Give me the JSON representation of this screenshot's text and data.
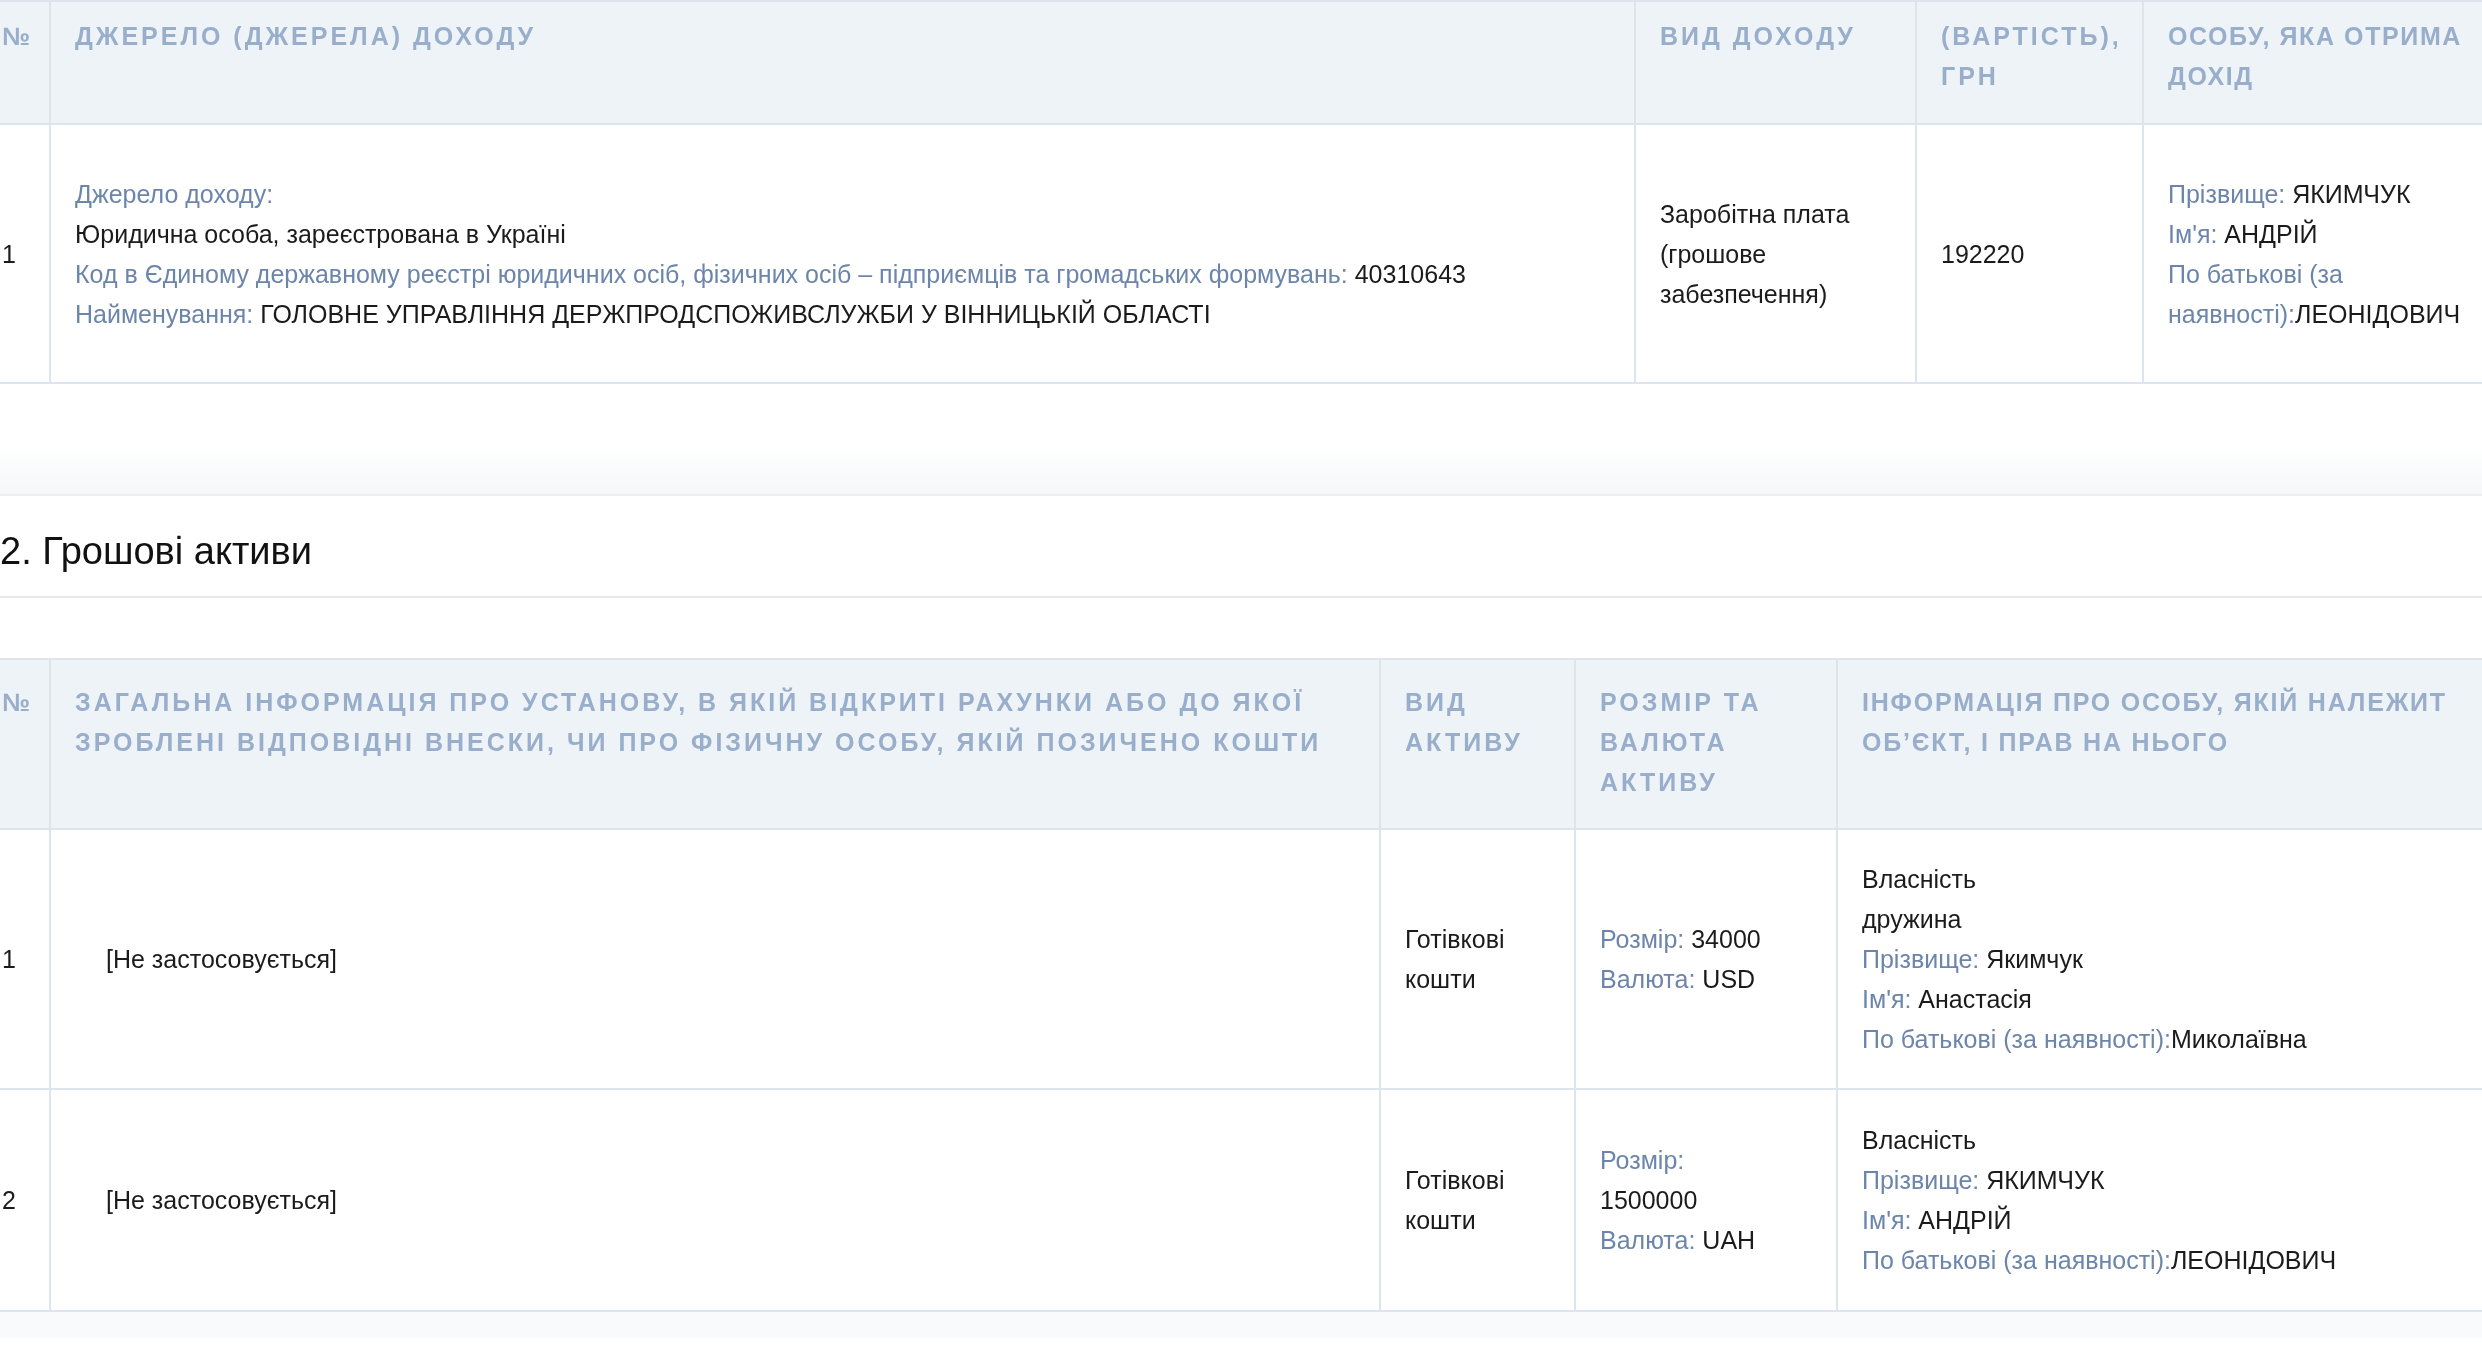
{
  "income_table": {
    "columns": [
      "№",
      "ДЖЕРЕЛО (ДЖЕРЕЛА) ДОХОДУ",
      "ВИД ДОХОДУ",
      "(ВАРТІСТЬ), ГРН",
      "ОСОБУ, ЯКА ОТРИМА ДОХІД"
    ],
    "rows": [
      {
        "number": "1",
        "source": [
          {
            "label": "Джерело доходу:"
          },
          {
            "value": "Юридична особа, зареєстрована в Україні"
          },
          {
            "label": "Код в Єдиному державному реєстрі юридичних осіб, фізичних осіб – підприємців та громадських формувань: ",
            "value": "40310643"
          },
          {
            "label": "Найменування: ",
            "value": "ГОЛОВНЕ УПРАВЛІННЯ ДЕРЖПРОДСПОЖИВСЛУЖБИ У ВІННИЦЬКІЙ ОБЛАСТІ"
          }
        ],
        "income_type": "Заробітна плата (грошове забезпечення)",
        "amount": "192220",
        "recipient": [
          {
            "label": "Прізвище: ",
            "value": "ЯКИМЧУК"
          },
          {
            "label": "Ім'я: ",
            "value": "АНДРІЙ"
          },
          {
            "label": "По батькові (за наявності):",
            "value": "ЛЕОНІДОВИЧ"
          }
        ]
      }
    ]
  },
  "section": {
    "title": "2. Грошові активи"
  },
  "assets_table": {
    "columns": [
      "№",
      "ЗАГАЛЬНА ІНФОРМАЦІЯ ПРО УСТАНОВУ, В ЯКІЙ ВІДКРИТІ РАХУНКИ АБО ДО ЯКОЇ ЗРОБЛЕНІ ВІДПОВІДНІ ВНЕСКИ, ЧИ ПРО ФІЗИЧНУ ОСОБУ, ЯКІЙ ПОЗИЧЕНО КОШТИ",
      "ВИД АКТИВУ",
      "РОЗМІР ТА ВАЛЮТА АКТИВУ",
      "ІНФОРМАЦІЯ ПРО ОСОБУ, ЯКІЙ НАЛЕЖИТ ОБ’ЄКТ, І ПРАВ НА НЬОГО"
    ],
    "rows": [
      {
        "number": "1",
        "institution": "[Не застосовується]",
        "asset_type": "Готівкові кошти",
        "size": [
          {
            "label": "Розмір: ",
            "value": "34000"
          },
          {
            "label": "Валюта: ",
            "value": "USD"
          }
        ],
        "owner": [
          {
            "value": "Власність"
          },
          {
            "value": "дружина"
          },
          {
            "label": "Прізвище: ",
            "value": "Якимчук"
          },
          {
            "label": "Ім'я: ",
            "value": "Анастасія"
          },
          {
            "label": "По батькові (за наявності):",
            "value": "Миколаївна"
          }
        ]
      },
      {
        "number": "2",
        "institution": "[Не застосовується]",
        "asset_type": "Готівкові кошти",
        "size": [
          {
            "label": "Розмір: ",
            "value": "1500000"
          },
          {
            "label": "Валюта: ",
            "value": "UAH"
          }
        ],
        "owner": [
          {
            "value": "Власність"
          },
          {
            "label": "Прізвище: ",
            "value": "ЯКИМЧУК"
          },
          {
            "label": "Ім'я: ",
            "value": "АНДРІЙ"
          },
          {
            "label": "По батькові (за наявності):",
            "value": "ЛЕОНІДОВИЧ"
          }
        ]
      }
    ]
  }
}
